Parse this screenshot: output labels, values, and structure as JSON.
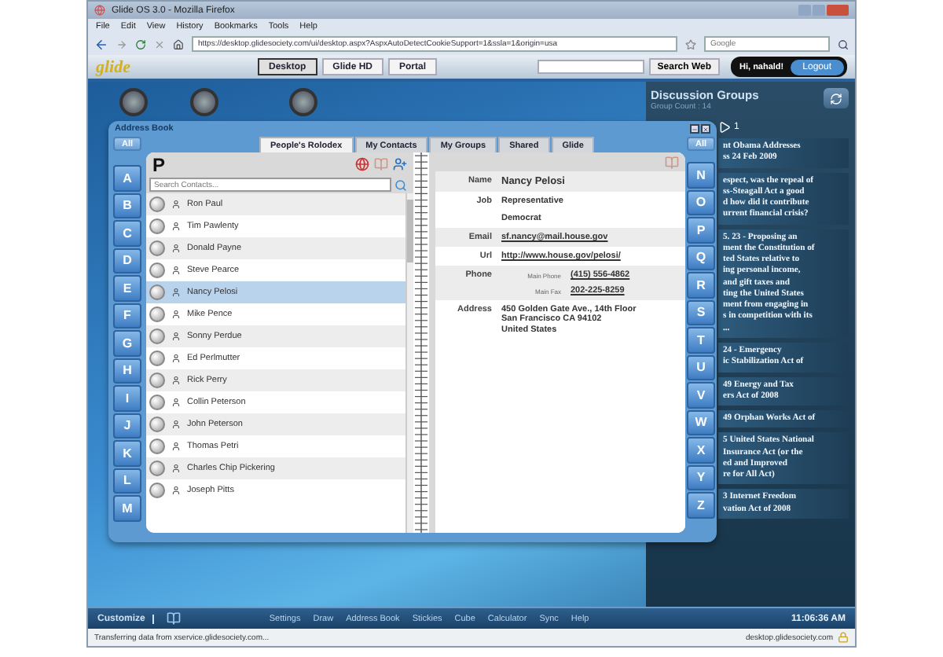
{
  "browser": {
    "title": "Glide OS 3.0 - Mozilla Firefox",
    "menu": [
      "File",
      "Edit",
      "View",
      "History",
      "Bookmarks",
      "Tools",
      "Help"
    ],
    "url": "https://desktop.glidesociety.com/ui/desktop.aspx?AspxAutoDetectCookieSupport=1&ssla=1&origin=usa",
    "search_placeholder": "Google"
  },
  "toolbar": {
    "logo": "glide",
    "buttons": [
      {
        "label": "Desktop",
        "selected": true
      },
      {
        "label": "Glide HD",
        "selected": false
      },
      {
        "label": "Portal",
        "selected": false
      }
    ],
    "search_button": "Search Web",
    "greeting": "Hi, nahald!",
    "logout": "Logout"
  },
  "address_book": {
    "title": "Address Book",
    "all_left": "All",
    "all_right": "All",
    "tabs": [
      {
        "label": "People's Rolodex",
        "selected": true
      },
      {
        "label": "My Contacts",
        "selected": false
      },
      {
        "label": "My Groups",
        "selected": false
      },
      {
        "label": "Shared",
        "selected": false
      },
      {
        "label": "Glide",
        "selected": false
      }
    ],
    "letters_left": [
      "A",
      "B",
      "C",
      "D",
      "E",
      "F",
      "G",
      "H",
      "I",
      "J",
      "K",
      "L",
      "M"
    ],
    "letters_right": [
      "N",
      "O",
      "P",
      "Q",
      "R",
      "S",
      "T",
      "U",
      "V",
      "W",
      "X",
      "Y",
      "Z"
    ],
    "current_letter": "P",
    "search_placeholder": "Search Contacts...",
    "contacts": [
      {
        "name": "Ron Paul",
        "selected": false
      },
      {
        "name": "Tim Pawlenty",
        "selected": false
      },
      {
        "name": "Donald Payne",
        "selected": false
      },
      {
        "name": "Steve Pearce",
        "selected": false
      },
      {
        "name": "Nancy Pelosi",
        "selected": true
      },
      {
        "name": "Mike Pence",
        "selected": false
      },
      {
        "name": "Sonny Perdue",
        "selected": false
      },
      {
        "name": "Ed Perlmutter",
        "selected": false
      },
      {
        "name": "Rick Perry",
        "selected": false
      },
      {
        "name": "Collin Peterson",
        "selected": false
      },
      {
        "name": "John Peterson",
        "selected": false
      },
      {
        "name": "Thomas Petri",
        "selected": false
      },
      {
        "name": "Charles Chip Pickering",
        "selected": false
      },
      {
        "name": "Joseph Pitts",
        "selected": false
      }
    ],
    "details": [
      {
        "kind": "text",
        "label": "Name",
        "values": [
          "Nancy Pelosi"
        ]
      },
      {
        "kind": "text",
        "label": "Job",
        "values": [
          "Representative",
          "Democrat"
        ]
      },
      {
        "kind": "link",
        "label": "Email",
        "values": [
          "sf.nancy@mail.house.gov"
        ]
      },
      {
        "kind": "link",
        "label": "Url",
        "values": [
          "http://www.house.gov/pelosi/"
        ]
      },
      {
        "kind": "phone",
        "label": "Phone",
        "entries": [
          {
            "label": "Main Phone",
            "value": "(415) 556-4862"
          },
          {
            "label": "Main Fax",
            "value": "202-225-8259"
          }
        ]
      },
      {
        "kind": "address",
        "label": "Address",
        "values": [
          "450 Golden Gate Ave., 14th Floor",
          "San Francisco CA 94102",
          "United States"
        ]
      }
    ]
  },
  "discussion": {
    "title": "Discussion Groups",
    "count": "Group Count : 14",
    "badge": "1",
    "items": [
      "nt Obama Addresses\nss 24 Feb 2009",
      "espect, was the repeal of\nss-Steagall Act a good\nd how did it contribute\nurrent financial crisis?",
      "5. 23 - Proposing an\nment the Constitution of\nted States relative to\ning personal income,\nand gift taxes and\nting the United States\nment from engaging in\ns in competition with its\n...",
      "24 - Emergency\nic Stabilization Act of",
      "49 Energy and Tax\ners Act of 2008",
      "49 Orphan Works Act of",
      "5 United States National\nInsurance Act (or the\ned and Improved\nre for All Act)",
      "3 Internet Freedom\nvation Act of 2008"
    ]
  },
  "taskbar": {
    "customize": "Customize",
    "apps": [
      "Settings",
      "Draw",
      "Address Book",
      "Stickies",
      "Cube",
      "Calculator",
      "Sync",
      "Help"
    ],
    "time": "11:06:36 AM"
  },
  "status": {
    "left": "Transferring data from xservice.glidesociety.com...",
    "right": "desktop.glidesociety.com"
  }
}
